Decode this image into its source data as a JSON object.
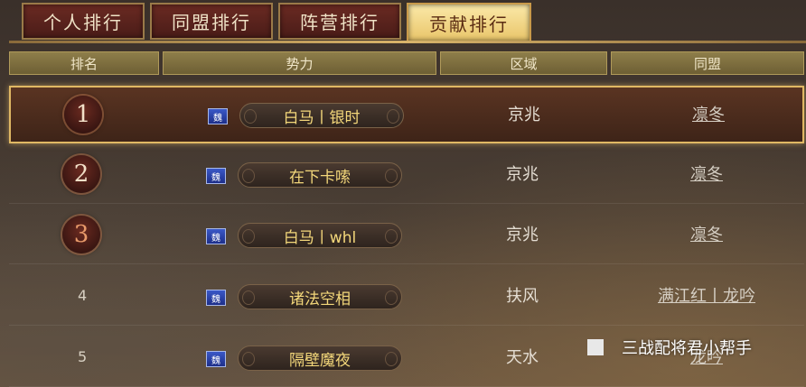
{
  "tabs": [
    {
      "label": "个人排行",
      "active": false
    },
    {
      "label": "同盟排行",
      "active": false
    },
    {
      "label": "阵营排行",
      "active": false
    },
    {
      "label": "贡献排行",
      "active": true
    }
  ],
  "columns": [
    "排名",
    "势力",
    "区域",
    "同盟"
  ],
  "rows": [
    {
      "rank": "1",
      "faction_icon": "魏",
      "force": "白马丨银时",
      "region": "京兆",
      "alliance": "凛冬"
    },
    {
      "rank": "2",
      "faction_icon": "魏",
      "force": "在下卡嗦",
      "region": "京兆",
      "alliance": "凛冬"
    },
    {
      "rank": "3",
      "faction_icon": "魏",
      "force": "白马丨whl",
      "region": "京兆",
      "alliance": "凛冬"
    },
    {
      "rank": "4",
      "faction_icon": "魏",
      "force": "诸法空相",
      "region": "扶风",
      "alliance": "满江红丨龙吟"
    },
    {
      "rank": "5",
      "faction_icon": "魏",
      "force": "隔壁魔夜",
      "region": "天水",
      "alliance": "龙吟"
    }
  ],
  "watermark": {
    "text": "三战配将君小帮手"
  },
  "colors": {
    "accent": "#e9c56a",
    "force_text": "#f3d77a",
    "faction_flag": "#2a44b0"
  }
}
